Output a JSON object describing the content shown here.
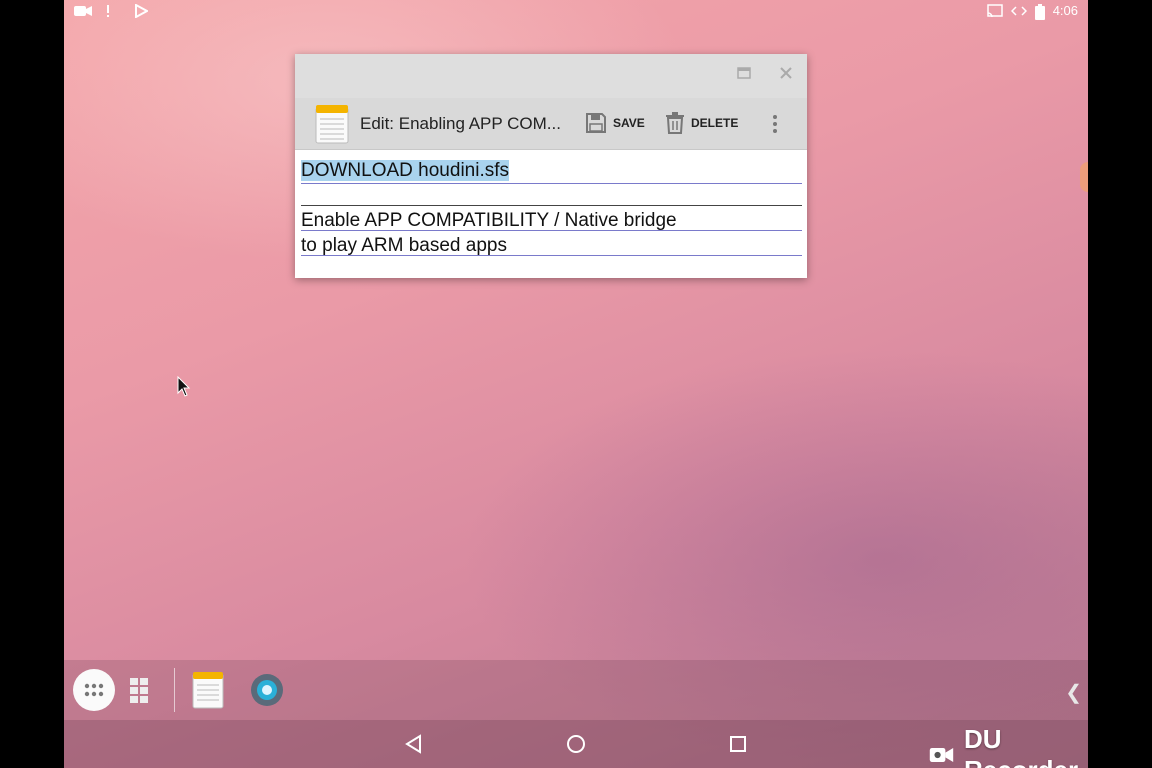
{
  "status_bar": {
    "time": "4:06",
    "left_icons": [
      "video-camera-icon",
      "alert-icon",
      "play-store-icon"
    ],
    "right_icons": [
      "cast-icon",
      "code-icon",
      "battery-icon"
    ]
  },
  "note_window": {
    "edit_title": "Edit: Enabling APP COM...",
    "save_label": "SAVE",
    "delete_label": "DELETE",
    "title_field": "DOWNLOAD houdini.sfs",
    "body_field_line1": "Enable APP COMPATIBILITY / Native bridge",
    "body_field_line2": "to play ARM based apps"
  },
  "taskbar": {
    "items": [
      "app-drawer-icon",
      "recent-apps-grid-icon",
      "notepad-app-icon",
      "camera-app-icon"
    ]
  },
  "navigation": [
    "back-icon",
    "home-icon",
    "recents-icon"
  ],
  "watermark": {
    "text": "DU Recorder"
  },
  "colors": {
    "selection_highlight": "#a9d3ee",
    "field_underline": "#7a7acb",
    "toolbar_bg": "#d9d9d9"
  }
}
